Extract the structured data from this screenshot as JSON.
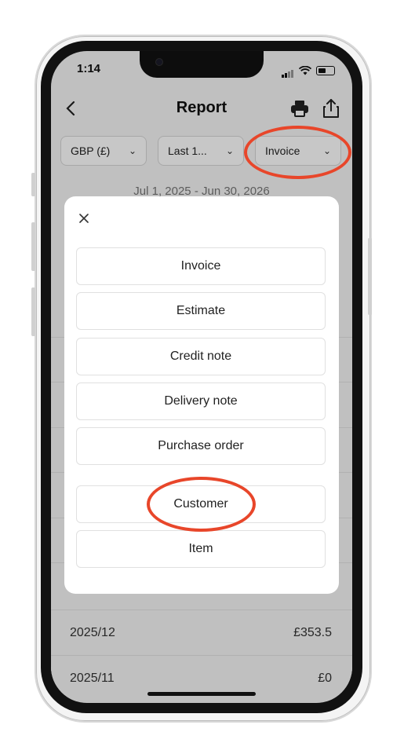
{
  "status_bar": {
    "time": "1:14"
  },
  "header": {
    "title": "Report",
    "back_icon": "chevron-left-icon",
    "print_icon": "printer-icon",
    "share_icon": "share-icon"
  },
  "filters": {
    "currency": "GBP (£)",
    "period": "Last 1...",
    "document_type": "Invoice"
  },
  "date_range": "Jul 1, 2025 - Jun 30, 2026",
  "report_rows": [
    {
      "period": "2025/12",
      "amount": "£353.5"
    },
    {
      "period": "2025/11",
      "amount": "£0"
    }
  ],
  "modal": {
    "close_icon": "close-icon",
    "options": [
      {
        "label": "Invoice"
      },
      {
        "label": "Estimate"
      },
      {
        "label": "Credit note"
      },
      {
        "label": "Delivery note"
      },
      {
        "label": "Purchase order"
      },
      {
        "label": "Customer"
      },
      {
        "label": "Item"
      }
    ]
  },
  "colors": {
    "highlight": "#e8462a",
    "overlay": "rgba(0,0,0,0.22)"
  }
}
